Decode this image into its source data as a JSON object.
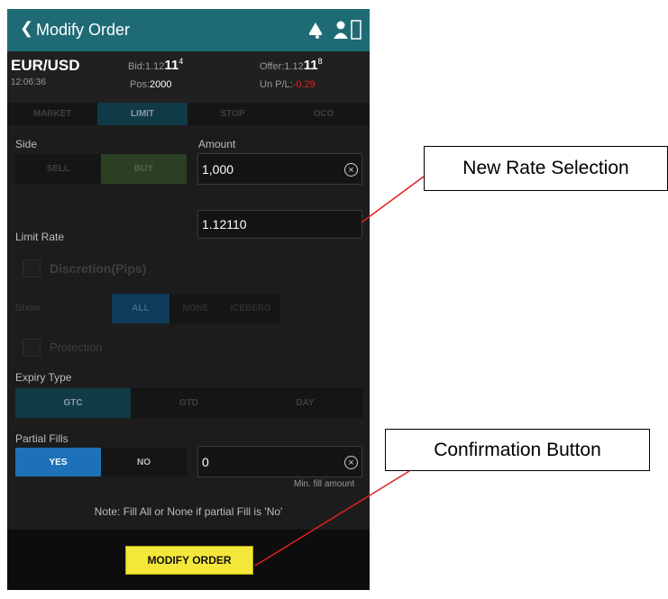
{
  "header": {
    "back_glyph": "❮",
    "title": "Modify Order",
    "icons": [
      "bell-icon",
      "person-icon"
    ]
  },
  "quote": {
    "symbol": "EUR/USD",
    "time": "12:06:36",
    "bid_prefix": "Bid:1.12",
    "bid_big": "11",
    "bid_sup": "4",
    "pos_label": "Pos:",
    "pos_value": "2000",
    "offer_prefix": "Offer:1.12",
    "offer_big": "11",
    "offer_sup": "8",
    "upl_label": "Un P/L:",
    "upl_value": "-0.29"
  },
  "order_tabs": [
    "MARKET",
    "LIMIT",
    "STOP",
    "OCO"
  ],
  "order_tab_selected": "LIMIT",
  "side": {
    "label": "Side",
    "options": [
      "SELL",
      "BUY"
    ],
    "selected": "BUY"
  },
  "amount": {
    "label": "Amount",
    "value": "1,000"
  },
  "limit_rate": {
    "label": "Limit Rate",
    "value": "1.12110"
  },
  "discretion": {
    "label": "Discretion(Pips)"
  },
  "show": {
    "label": "Show",
    "options": [
      "ALL",
      "NONE",
      "ICEBERG"
    ],
    "selected": "ALL"
  },
  "protection": {
    "label": "Protection"
  },
  "expiry": {
    "label": "Expiry Type",
    "options": [
      "GTC",
      "GTD",
      "DAY"
    ],
    "selected": "GTC"
  },
  "partial_fills": {
    "label": "Partial Fills",
    "options": [
      "YES",
      "NO"
    ],
    "selected": "YES",
    "value": "0",
    "min_label": "Min. fill amount"
  },
  "note": "Note: Fill All or None if partial Fill is 'No'",
  "modify_button": "MODIFY ORDER",
  "callouts": {
    "rate": "New Rate Selection",
    "confirm": "Confirmation Button"
  },
  "colors": {
    "header": "#1e6b75",
    "button": "#f5e73a",
    "accent_blue": "#1d71b8",
    "callout_line": "#e02020"
  }
}
